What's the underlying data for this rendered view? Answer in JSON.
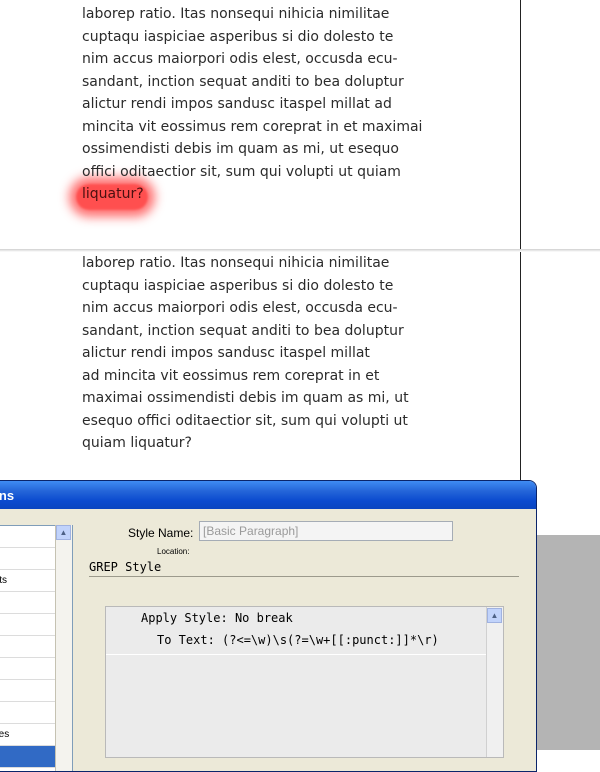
{
  "document": {
    "paragraph_top": [
      "laborep ratio. Itas nonsequi nihicia nimilitae",
      "cuptaqu iaspiciae asperibus si dio dolesto te",
      "nim accus maiorpori odis elest, occusda ecu-",
      "sandant, inction sequat anditi to bea doluptur",
      "alictur rendi impos sandusc itaspel millat ad",
      "mincita vit eossimus rem coreprat in et maximai",
      "ossimendisti debis im quam as mi, ut esequo",
      "offici oditaectior sit, sum qui volupti ut quiam"
    ],
    "highlighted_word": "liquatur?",
    "paragraph_bottom": [
      "laborep ratio. Itas nonsequi nihicia nimilitae",
      "cuptaqu iaspiciae asperibus si dio dolesto te",
      "nim accus maiorpori odis elest, occusda ecu-",
      "sandant, inction sequat anditi to bea doluptur",
      "alictur rendi impos sandusc itaspel millat",
      "ad mincita vit eossimus rem coreprat in et",
      "maximai ossimendisti debis im quam as mi, ut",
      "esequo offici oditaectior sit, sum qui volupti ut",
      "quiam liquatur?"
    ]
  },
  "dialog": {
    "title": "tions",
    "left_list": [
      "",
      "",
      "rmats",
      "",
      "",
      "",
      "",
      "",
      "",
      "Styles",
      ""
    ],
    "style_name_label": "Style Name:",
    "style_name_value": "[Basic Paragraph]",
    "location_label": "Location:",
    "section_title": "GREP Style",
    "rule": {
      "apply_style_label": "Apply Style:",
      "apply_style_value": "No break",
      "to_text_label": "To Text:",
      "to_text_value": "(?<=\\w)\\s(?=\\w+[[:punct:]]*\\r)"
    }
  },
  "colors": {
    "highlight": "#ff2020",
    "titlebar": "#0b4bcf",
    "selection": "#316ac5",
    "dialog_bg": "#ece9d8"
  },
  "icons": {
    "scroll_up": "scroll-up-arrow-icon"
  }
}
